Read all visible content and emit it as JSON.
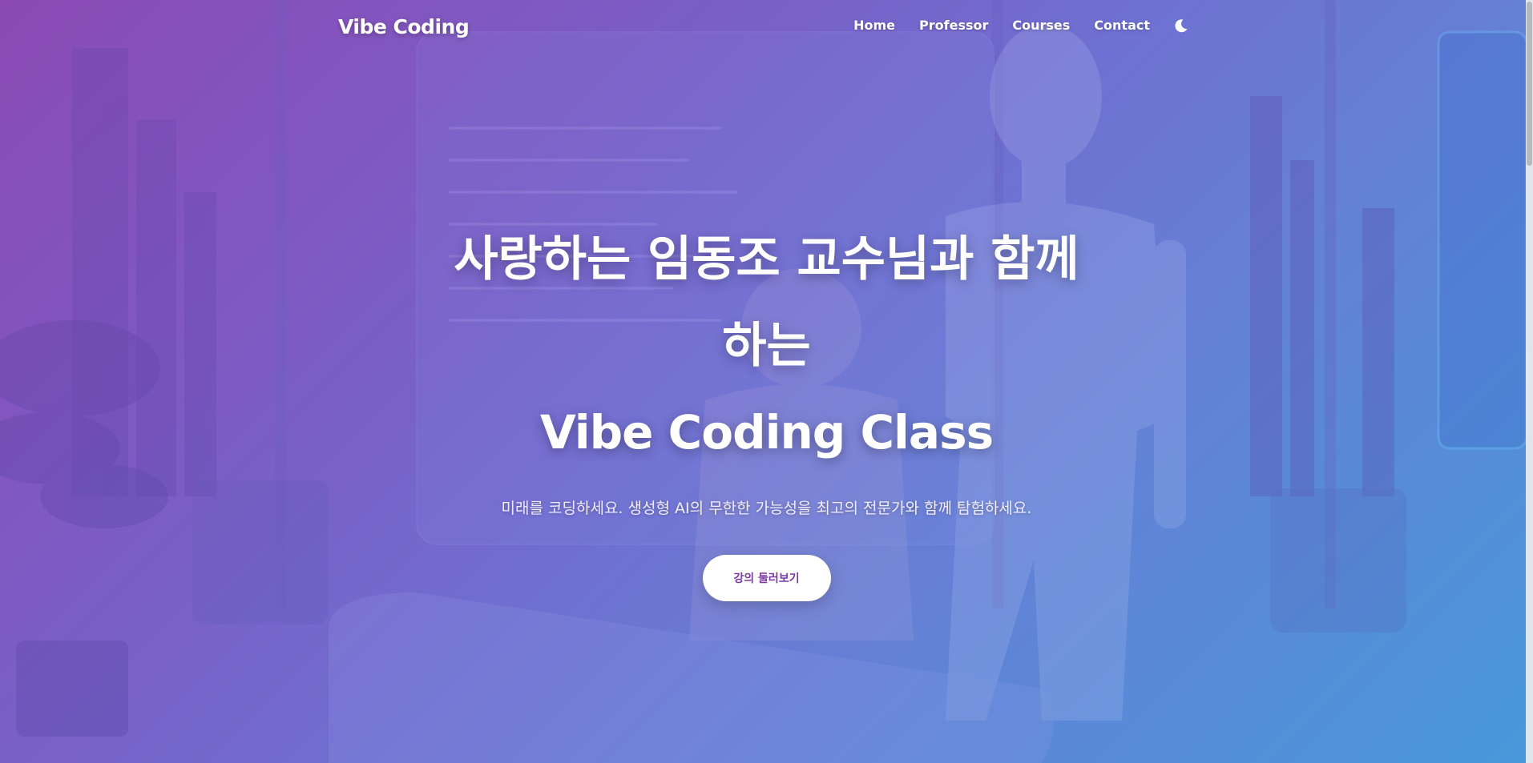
{
  "nav": {
    "brand": "Vibe Coding",
    "links": [
      {
        "label": "Home"
      },
      {
        "label": "Professor"
      },
      {
        "label": "Courses"
      },
      {
        "label": "Contact"
      }
    ],
    "theme_toggle_icon": "moon-icon"
  },
  "hero": {
    "title_line1": "사랑하는 임동조 교수님과 함께 하는",
    "title_line2": "Vibe Coding Class",
    "subtitle": "미래를 코딩하세요. 생성형 AI의 무한한 가능성을 최고의 전문가와 함께 탐험하세요.",
    "cta_label": "강의 둘러보기"
  },
  "colors": {
    "accent": "#7a3aa0",
    "gradient_start": "#8a4fb4",
    "gradient_end": "#4a9ad8",
    "text": "#ffffff"
  }
}
